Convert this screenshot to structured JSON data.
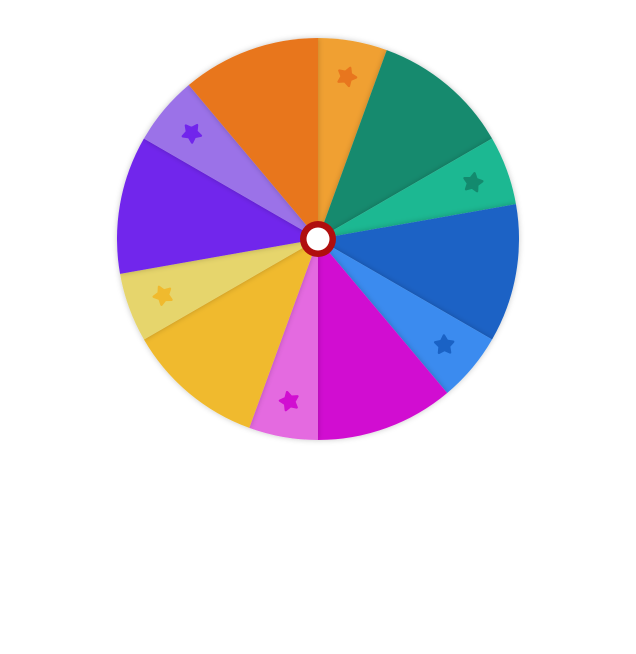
{
  "wheel": {
    "segments": [
      {
        "name": "segment-orange-light-small",
        "color": "#F0A030",
        "star": "#E8761E",
        "weight": 0.5
      },
      {
        "name": "segment-teal-dark",
        "color": "#138A6E",
        "star": null,
        "weight": 1
      },
      {
        "name": "segment-teal-light-small",
        "color": "#1DB892",
        "star": "#138A6E",
        "weight": 0.5
      },
      {
        "name": "segment-blue-dark",
        "color": "#1A62C5",
        "star": null,
        "weight": 1
      },
      {
        "name": "segment-blue-light-small",
        "color": "#3A8BEF",
        "star": "#1A62C5",
        "weight": 0.5
      },
      {
        "name": "segment-magenta",
        "color": "#D10ED1",
        "star": null,
        "weight": 1
      },
      {
        "name": "segment-pink-small",
        "color": "#E46BE0",
        "star": "#D10ED1",
        "weight": 0.5
      },
      {
        "name": "segment-yellow",
        "color": "#F0BA2E",
        "star": null,
        "weight": 1
      },
      {
        "name": "segment-yellow-light-small",
        "color": "#E6D56C",
        "star": "#F0BA2E",
        "weight": 0.5
      },
      {
        "name": "segment-purple",
        "color": "#7125EC",
        "star": null,
        "weight": 1
      },
      {
        "name": "segment-lavender-small",
        "color": "#9B72E8",
        "star": "#7125EC",
        "weight": 0.5
      },
      {
        "name": "segment-orange",
        "color": "#E8761E",
        "star": null,
        "weight": 1
      }
    ],
    "hub": {
      "ring_color": "#B00E0E",
      "center_color": "#FFFFFF"
    },
    "icons": {
      "segment_marker": "star-icon",
      "hub": "hub-icon"
    }
  }
}
